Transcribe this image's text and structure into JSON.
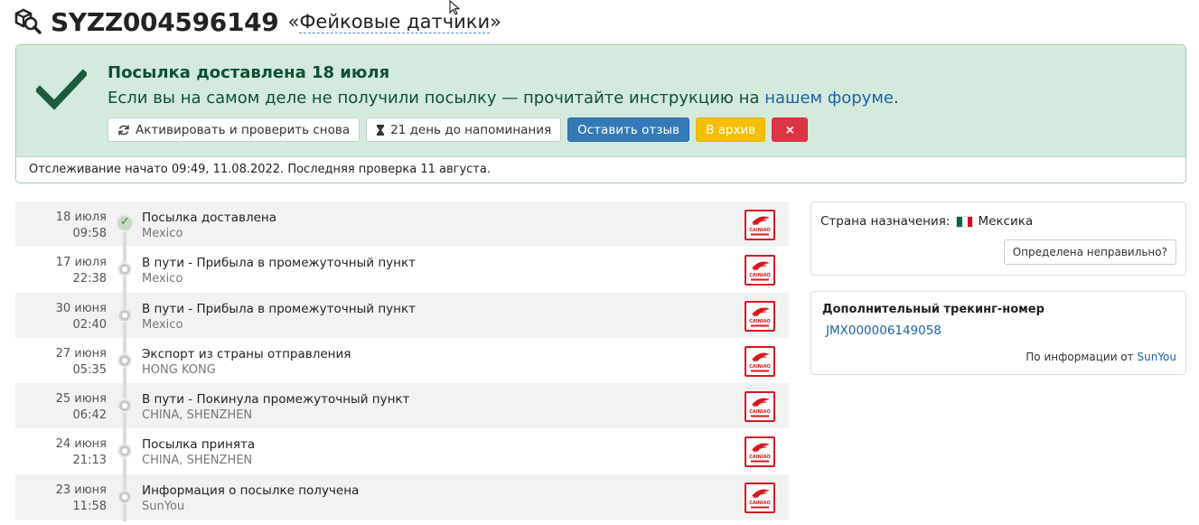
{
  "header": {
    "tracking_number": "SYZZ004596149",
    "open_quote": "«",
    "title": "Фейковые датчики",
    "close_quote": "»"
  },
  "status": {
    "title": "Посылка доставлена 18 июля",
    "message_prefix": "Если вы на самом деле не получили посылку — прочитайте инструкцию на ",
    "message_link": "нашем форуме",
    "message_suffix": ".",
    "buttons": {
      "reactivate": "Активировать и проверить снова",
      "reminder": "21 день до напоминания",
      "review": "Оставить отзыв",
      "archive": "В архив",
      "delete": "×"
    },
    "footer": "Отслеживание начато 09:49, 11.08.2022. Последняя проверка 11 августа."
  },
  "events": [
    {
      "date": "18 июля",
      "time": "09:58",
      "description": "Посылка доставлена",
      "location": "Mexico",
      "delivered": true
    },
    {
      "date": "17 июля",
      "time": "22:38",
      "description": "В пути - Прибыла в промежуточный пункт",
      "location": "Mexico",
      "delivered": false
    },
    {
      "date": "30 июня",
      "time": "02:40",
      "description": "В пути - Прибыла в промежуточный пункт",
      "location": "Mexico",
      "delivered": false
    },
    {
      "date": "27 июня",
      "time": "05:35",
      "description": "Экспорт из страны отправления",
      "location": "HONG KONG",
      "delivered": false
    },
    {
      "date": "25 июня",
      "time": "06:42",
      "description": "В пути - Покинула промежуточный пункт",
      "location": "CHINA, SHENZHEN",
      "delivered": false
    },
    {
      "date": "24 июня",
      "time": "21:13",
      "description": "Посылка принята",
      "location": "CHINA, SHENZHEN",
      "delivered": false
    },
    {
      "date": "23 июня",
      "time": "11:58",
      "description": "Информация о посылке получена",
      "location": "SunYou",
      "delivered": false
    }
  ],
  "courier_logo_text": "CAINIAO",
  "destination": {
    "label": "Страна назначения:",
    "country": "Мексика",
    "flag_colors": [
      "#006847",
      "#ffffff",
      "#ce1126"
    ],
    "wrong_button": "Определена неправильно?"
  },
  "extra_tracking": {
    "heading": "Дополнительный трекинг-номер",
    "number": "JMX000006149058",
    "source_prefix": "По информации от",
    "source_name": "SunYou"
  },
  "colors": {
    "success_bg": "#d4eadd",
    "success_text": "#0f5132",
    "link": "#1a63a8",
    "primary": "#337ab7",
    "warning": "#f5c000",
    "danger": "#dc3545",
    "courier_red": "#d7191f"
  }
}
